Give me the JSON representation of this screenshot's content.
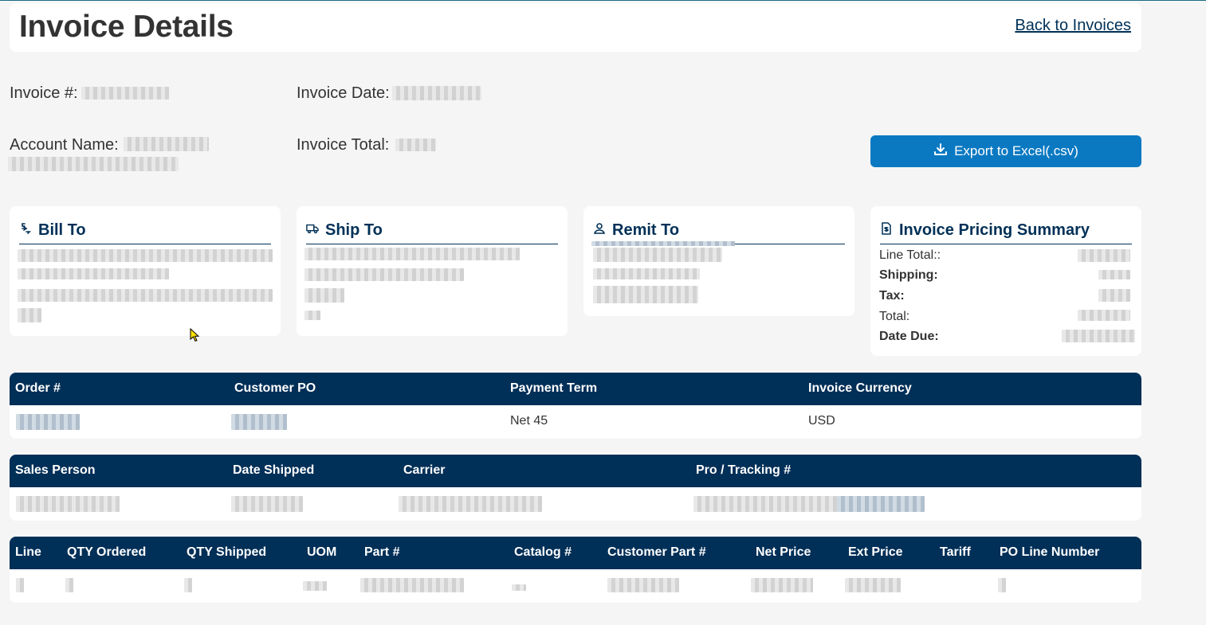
{
  "header": {
    "title": "Invoice Details",
    "back_link": "Back to Invoices"
  },
  "invoice_info": {
    "invoice_number_label": "Invoice #:",
    "invoice_date_label": "Invoice Date:",
    "account_name_label": "Account Name:",
    "invoice_total_label": "Invoice Total:"
  },
  "actions": {
    "export_label": "Export to Excel(.csv)",
    "export_icon": "download-icon"
  },
  "cards": {
    "bill_to": {
      "title": "Bill To",
      "icon": "dollar-arrow-icon"
    },
    "ship_to": {
      "title": "Ship To",
      "icon": "truck-icon"
    },
    "remit_to": {
      "title": "Remit To",
      "icon": "user-icon"
    },
    "pricing_summary": {
      "title": "Invoice Pricing Summary",
      "icon": "document-icon",
      "rows": [
        "Line Total::",
        "Shipping:",
        "Tax:",
        "Total:",
        "Date Due:"
      ]
    }
  },
  "order_table": {
    "headers": [
      "Order #",
      "Customer PO",
      "Payment Term",
      "Invoice Currency"
    ],
    "payment_term": "Net 45",
    "currency": "USD"
  },
  "shipping_table": {
    "headers": [
      "Sales Person",
      "Date Shipped",
      "Carrier",
      "Pro / Tracking #"
    ]
  },
  "lines_table": {
    "headers": [
      "Line",
      "QTY Ordered",
      "QTY Shipped",
      "UOM",
      "Part #",
      "Catalog #",
      "Customer Part #",
      "Net Price",
      "Ext Price",
      "Tariff",
      "PO Line Number"
    ]
  },
  "colors": {
    "navy": "#002f57",
    "accent_blue": "#0a79c2",
    "background": "#f5f5f5"
  }
}
